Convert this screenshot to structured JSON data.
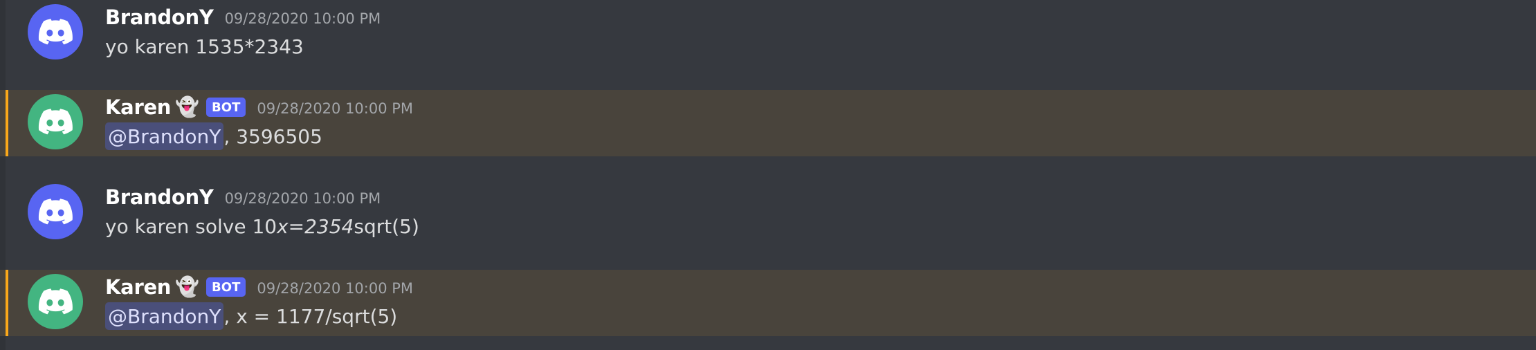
{
  "colors": {
    "background": "#36393f",
    "highlight_bg": "#49443c",
    "highlight_bar": "#faa81a",
    "user_avatar": "#5865f2",
    "bot_avatar": "#43b581",
    "bot_tag": "#5865f2",
    "mention_bg": "#4a4f7a"
  },
  "messages": [
    {
      "author": "BrandonY",
      "avatar_icon": "discord-logo-icon",
      "timestamp": "09/28/2020 10:00 PM",
      "content": "yo karen 1535*2343"
    },
    {
      "author": "Karen",
      "author_emoji": "👻",
      "bot_tag": "BOT",
      "avatar_icon": "discord-logo-icon",
      "timestamp": "09/28/2020 10:00 PM",
      "mention": "@BrandonY",
      "content": ", 3596505"
    },
    {
      "author": "BrandonY",
      "avatar_icon": "discord-logo-icon",
      "timestamp": "09/28/2020 10:00 PM",
      "content_prefix": "yo karen solve 10",
      "content_italic": "x=2354",
      "content_suffix": "sqrt(5)"
    },
    {
      "author": "Karen",
      "author_emoji": "👻",
      "bot_tag": "BOT",
      "avatar_icon": "discord-logo-icon",
      "timestamp": "09/28/2020 10:00 PM",
      "mention": "@BrandonY",
      "content": ", x = 1177/sqrt(5)"
    }
  ]
}
